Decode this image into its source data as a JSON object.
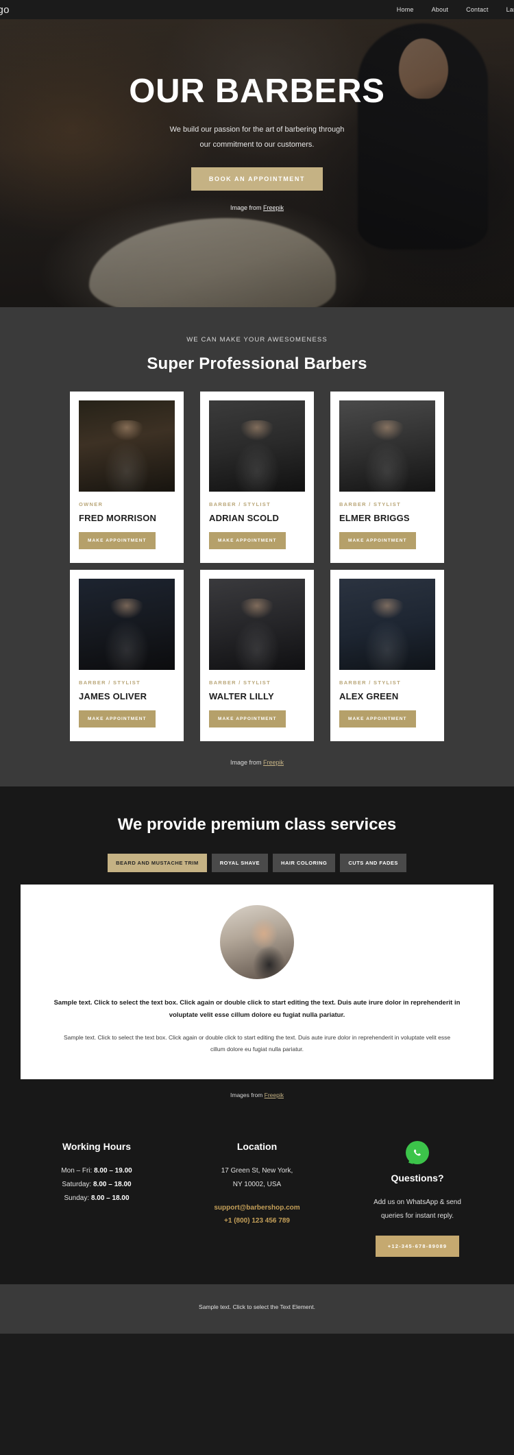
{
  "nav": {
    "logo": "ogo",
    "links": [
      {
        "label": "Home"
      },
      {
        "label": "About"
      },
      {
        "label": "Contact"
      },
      {
        "label": "Landing"
      }
    ]
  },
  "hero": {
    "title": "OUR BARBERS",
    "subtitle_line1": "We build our passion for the art of barbering through",
    "subtitle_line2": "our commitment to our customers.",
    "cta_label": "BOOK AN APPOINTMENT",
    "credit_prefix": "Image from ",
    "credit_link": "Freepik"
  },
  "team": {
    "eyebrow": "WE CAN MAKE YOUR AWESOMENESS",
    "title": "Super Professional Barbers",
    "button_label": "MAKE APPOINTMENT",
    "members": [
      {
        "role": "OWNER",
        "name": "FRED MORRISON"
      },
      {
        "role": "BARBER / STYLIST",
        "name": "ADRIAN SCOLD"
      },
      {
        "role": "BARBER / STYLIST",
        "name": "ELMER BRIGGS"
      },
      {
        "role": "BARBER / STYLIST",
        "name": "JAMES OLIVER"
      },
      {
        "role": "BARBER / STYLIST",
        "name": "WALTER LILLY"
      },
      {
        "role": "BARBER / STYLIST",
        "name": "ALEX GREEN"
      }
    ],
    "credit_prefix": "Image from ",
    "credit_link": "Freepik"
  },
  "services": {
    "title": "We provide premium class services",
    "tabs": [
      {
        "label": "BEARD AND MUSTACHE TRIM",
        "active": true
      },
      {
        "label": "ROYAL SHAVE",
        "active": false
      },
      {
        "label": "HAIR COLORING",
        "active": false
      },
      {
        "label": "CUTS AND FADES",
        "active": false
      }
    ],
    "lead": "Sample text. Click to select the text box. Click again or double click to start editing the text. Duis aute irure dolor in reprehenderit in voluptate velit esse cillum dolore eu fugiat nulla pariatur.",
    "body": "Sample text. Click to select the text box. Click again or double click to start editing the text. Duis aute irure dolor in reprehenderit in voluptate velit esse cillum dolore eu fugiat nulla pariatur.",
    "credit_prefix": "Images from ",
    "credit_link": "Freepik"
  },
  "info": {
    "hours": {
      "title": "Working Hours",
      "rows": [
        {
          "day": "Mon – Fri: ",
          "time": "8.00 – 19.00"
        },
        {
          "day": "Saturday: ",
          "time": "8.00 – 18.00"
        },
        {
          "day": "Sunday: ",
          "time": "8.00 – 18.00"
        }
      ]
    },
    "location": {
      "title": "Location",
      "address_line1": "17 Green St, New York,",
      "address_line2": "NY 10002, USA",
      "email": "support@barbershop.com",
      "phone": "+1 (800) 123 456 789"
    },
    "whatsapp": {
      "icon": "whatsapp-icon",
      "title": "Questions?",
      "text_line1": "Add us on WhatsApp & send",
      "text_line2": "queries for instant reply.",
      "button_label": "+12-345-678-89089"
    }
  },
  "footer": {
    "text": "Sample text. Click to select the Text Element."
  },
  "colors": {
    "accent": "#c5b284",
    "accent_dark": "#b5a06a",
    "link_gold": "#c5a059",
    "whatsapp_green": "#3cc44a",
    "dark_bg": "#181818",
    "mid_bg": "#3a3a3a"
  }
}
